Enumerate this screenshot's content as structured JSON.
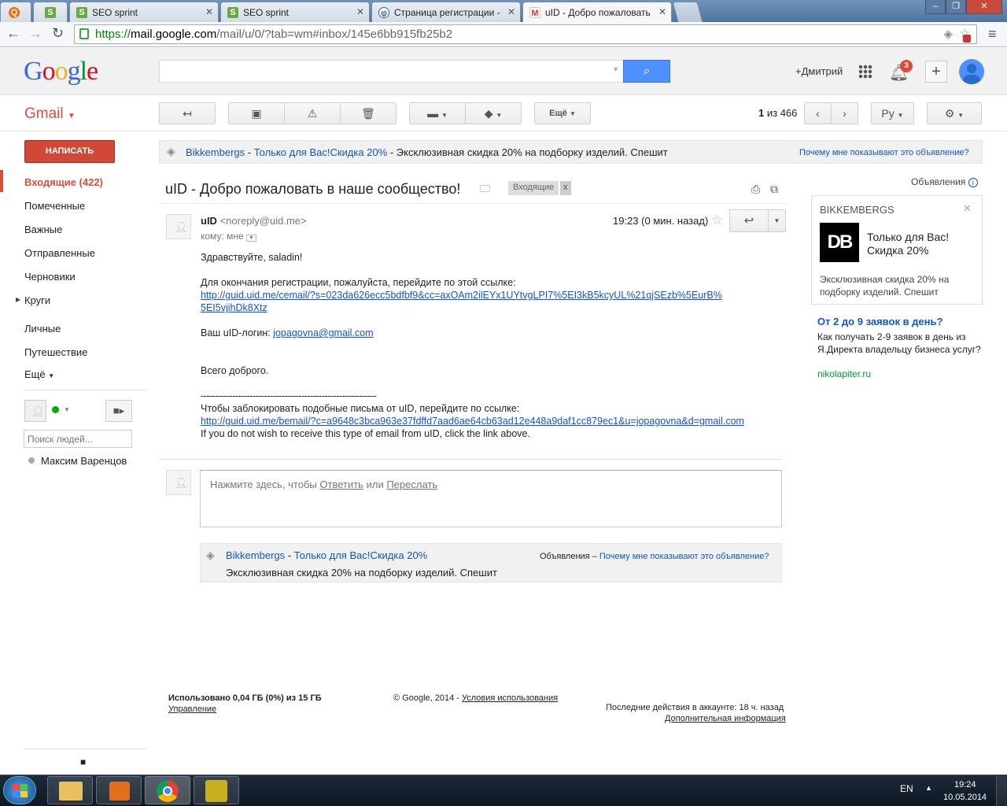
{
  "browser": {
    "tabs": [
      {
        "title": "",
        "icon": "orange-q-icon"
      },
      {
        "title": "SEO sprint",
        "icon": "seosprint-icon"
      },
      {
        "title": "SEO sprint",
        "icon": "seosprint-icon"
      },
      {
        "title": "Страница регистрации -",
        "icon": "uid-icon"
      },
      {
        "title": "uID - Добро пожаловать",
        "icon": "gmail-icon",
        "active": true
      }
    ],
    "url_scheme": "https://",
    "url_host": "mail.google.com",
    "url_path": "/mail/u/0/?tab=wm#inbox/145e6bb915fb25b2"
  },
  "header": {
    "logo": "Google",
    "user": "+Дмитрий",
    "notifications": "3"
  },
  "gmail": {
    "label": "Gmail",
    "more_label": "Ещё",
    "pagination_prefix": "1",
    "pagination_suffix": "из 466",
    "lang": "Ру"
  },
  "sidebar": {
    "compose": "НАПИСАТЬ",
    "items": [
      {
        "label": "Входящие (422)",
        "active": true
      },
      {
        "label": "Помеченные"
      },
      {
        "label": "Важные"
      },
      {
        "label": "Отправленные"
      },
      {
        "label": "Черновики"
      },
      {
        "label": "Круги"
      },
      {
        "label": "Личные"
      },
      {
        "label": "Путешествие"
      },
      {
        "label": "Ещё"
      }
    ],
    "people_placeholder": "Поиск людей...",
    "contact": "Максим Варенцов"
  },
  "topad": {
    "brand": "Bikkembergs",
    "dash": "-",
    "title": "Только для Вас!Скидка 20%",
    "text": "- Эксклюзивная скидка 20% на подборку изделий. Спешит",
    "why": "Почему мне показывают это объявление?"
  },
  "message": {
    "subject": "uID - Добро пожаловать в наше сообщество!",
    "label": "Входящие",
    "label_x": "x",
    "sender_name": "uID",
    "sender_email": "<noreply@uid.me>",
    "time": "19:23 (0 мин. назад)",
    "to": "кому: мне",
    "greeting": "Здравствуйте, saladin!",
    "p1": "Для окончания регистрации, пожалуйста, перейдите по этой ссылке:",
    "link1a": "http://guid.uid.me/cemail/?s=023da626ecc5bdfbf9&cc=axOAm2ilEYx1UYtvgLPI7%5EI3kB5kcyUL%21qjSEzb%5EurB%",
    "link1b": "5EI5vjihDk8Xtz",
    "login_label": "Ваш uID-логин:",
    "login": "jopagovna@gmail.com",
    "bye": "Всего доброго.",
    "divider": "-------------------------------------------------------------",
    "p2": "Чтобы заблокировать подобные письма от uID, перейдите по ссылке:",
    "link2": "http://guid.uid.me/bemail/?c=a9648c3bca963e37fdffd7aad6ae64cb63ad12e448a9daf1cc879ec1&u=jopagovna&d=gmail.com",
    "p3": "If you do not wish to receive this type of email from uID, click the link above."
  },
  "reply": {
    "prefix": "Нажмите здесь, чтобы",
    "reply": "Ответить",
    "or": "или",
    "forward": "Переслать"
  },
  "bottomad": {
    "brand": "Bikkembergs",
    "dash": "-",
    "title": "Только для Вас!Скидка 20%",
    "text": "Эксклюзивная скидка 20% на подборку изделий. Спешит",
    "ads": "Объявления –",
    "why": "Почему мне показывают это объявление?"
  },
  "rightads": {
    "heading": "Объявления",
    "card_brand": "BIKKEMBERGS",
    "card_logo": "DB",
    "card_title": "Только для Вас! Скидка 20%",
    "card_text": "Эксклюзивная скидка 20% на подборку изделий. Спешит",
    "ad2_title": "От 2 до 9 заявок в день?",
    "ad2_text": "Как получать 2-9 заявок в день из Я.Директа владельцу бизнеса услуг?",
    "ad2_url": "nikolapiter.ru"
  },
  "footer": {
    "usage": "Использовано 0,04 ГБ (0%) из 15 ГБ",
    "manage": "Управление",
    "copyright": "© Google, 2014 -",
    "terms": "Условия использования",
    "activity": "Последние действия в аккаунте: 18 ч. назад",
    "details": "Дополнительная информация"
  },
  "taskbar": {
    "lang": "EN",
    "time": "19:24",
    "date": "10.05.2014"
  },
  "colors": {
    "accent": "#dd4b39",
    "link": "#1155cc",
    "search": "#4d90fe"
  }
}
